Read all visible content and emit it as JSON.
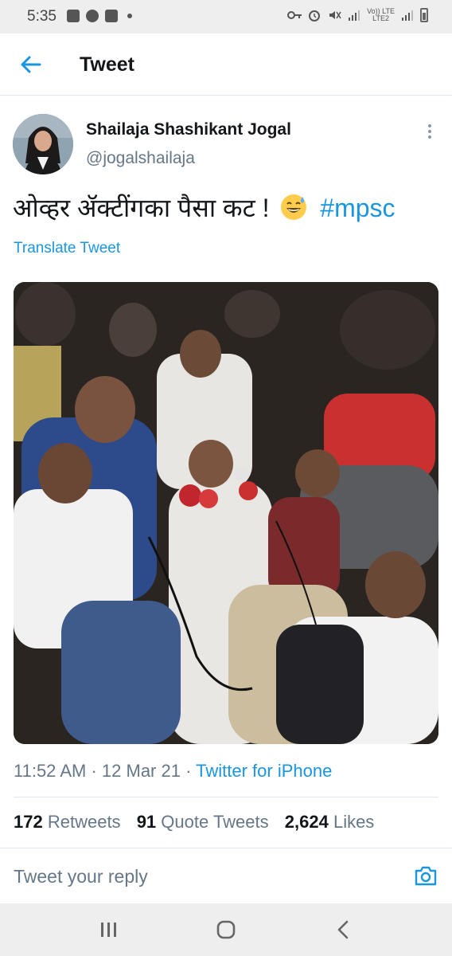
{
  "status_bar": {
    "time": "5:35",
    "network_label_1": "Vo)) LTE",
    "network_label_2": "LTE2"
  },
  "header": {
    "title": "Tweet",
    "back_icon": "arrow-left-icon",
    "accent_color": "#1b95e0"
  },
  "tweet": {
    "author_name": "Shailaja Shashikant Jogal",
    "author_handle": "@jogalshailaja",
    "text": "ओव्हर ॲक्टींगका पैसा कट !",
    "emoji": "grinning-face-with-sweat-emoji",
    "hashtag": "#mpsc",
    "translate_label": "Translate Tweet",
    "time": "11:52 AM",
    "date": "12 Mar 21",
    "source": "Twitter for iPhone",
    "separator": "·"
  },
  "stats": [
    {
      "count": "172",
      "label": "Retweets"
    },
    {
      "count": "91",
      "label": "Quote Tweets"
    },
    {
      "count": "2,624",
      "label": "Likes"
    }
  ],
  "reply": {
    "placeholder": "Tweet your reply",
    "camera_icon": "camera-icon"
  },
  "nav": {
    "icons": [
      "recent-apps-icon",
      "home-icon",
      "back-icon"
    ]
  }
}
